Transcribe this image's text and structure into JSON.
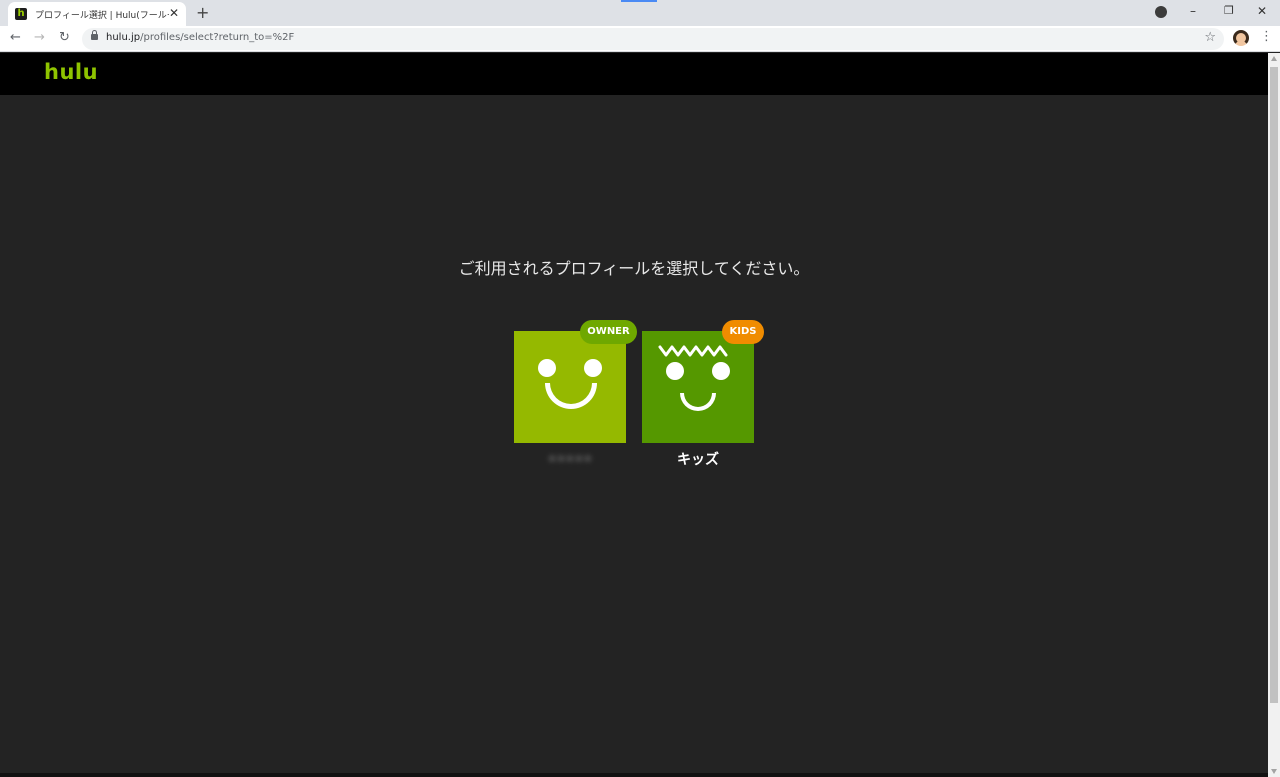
{
  "browser": {
    "tab_title": "プロフィール選択 | Hulu(フールー)【お試",
    "favicon_letter": "h",
    "close_glyph": "✕",
    "new_tab_glyph": "+",
    "url_host": "hulu.jp",
    "url_path": "/profiles/select?return_to=%2F",
    "back_glyph": "←",
    "forward_glyph": "→",
    "reload_glyph": "↻",
    "star_glyph": "☆",
    "menu_glyph": "⋮",
    "minimize_glyph": "–",
    "maximize_glyph": "❐",
    "window_close_glyph": "✕"
  },
  "header": {
    "logo_text": "hulu",
    "logo_color": "#8fc400"
  },
  "main": {
    "prompt": "ご利用されるプロフィールを選択してください。",
    "profiles": [
      {
        "badge": "OWNER",
        "name": "•••••",
        "tile_color": "#95b900",
        "badge_color": "#6fa800"
      },
      {
        "badge": "KIDS",
        "name": "キッズ",
        "tile_color": "#559800",
        "badge_color": "#f08c00"
      }
    ]
  }
}
